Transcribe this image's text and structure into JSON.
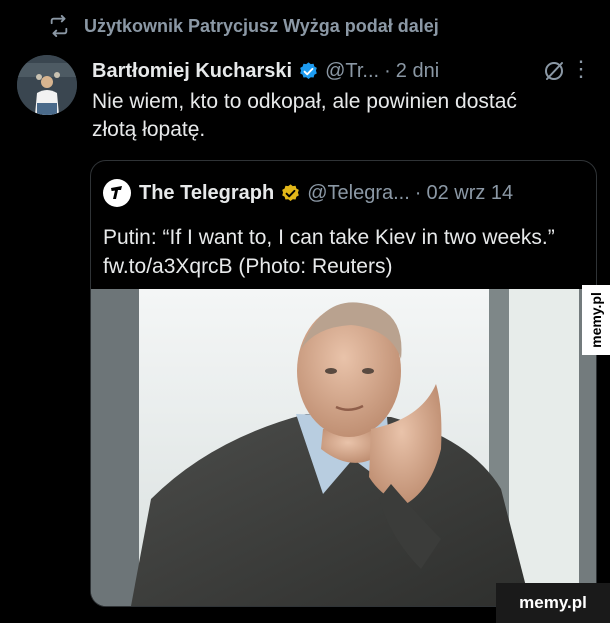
{
  "retweet": {
    "icon": "retweet-icon",
    "text": "Użytkownik Patrycjusz Wyżga podał dalej"
  },
  "tweet": {
    "author_name": "Bartłomiej Kucharski",
    "handle": "@Tr...",
    "separator": "·",
    "time": "2 dni",
    "text": "Nie wiem, kto to odkopał, ale powinien dostać złotą łopatę.",
    "more_label": "⋮"
  },
  "quote": {
    "author_name": "The Telegraph",
    "handle": "@Telegra...",
    "separator": "·",
    "date": "02 wrz 14",
    "text": "Putin: “If I want to, I can take Kiev in two weeks.” fw.to/a3XqrcB (Photo: Reuters)"
  },
  "watermark": {
    "side": "memy.pl",
    "bottom": "memy.pl"
  },
  "colors": {
    "background": "#000000",
    "text": "#e7e9ea",
    "muted": "#8b98a5",
    "verified_blue": "#1d9bf0",
    "verified_gold": "#e2b719",
    "border": "#2f3336"
  }
}
